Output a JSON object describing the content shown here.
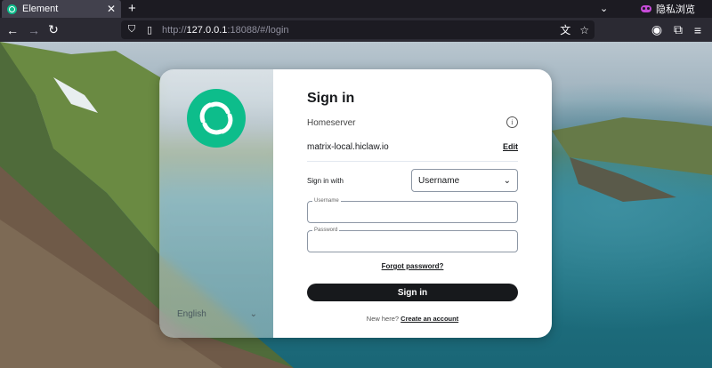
{
  "browser": {
    "tab": {
      "title": "Element",
      "favicon": "element-icon",
      "close_label": "✕"
    },
    "new_tab_label": "+",
    "private_label": "隐私浏览",
    "url": {
      "prefix": "http://",
      "host": "127.0.0.1",
      "rest": ":18088/#/login"
    }
  },
  "login": {
    "title": "Sign in",
    "homeserver_label": "Homeserver",
    "homeserver_value": "matrix-local.hiclaw.io",
    "edit_label": "Edit",
    "sign_in_with_label": "Sign in with",
    "method_selected": "Username",
    "username_label": "Username",
    "password_label": "Password",
    "forgot_label": "Forgot password?",
    "submit_label": "Sign in",
    "new_here_label": "New here?",
    "create_account_label": "Create an account"
  },
  "language": {
    "selected": "English"
  },
  "colors": {
    "brand": "#0dbd8b",
    "button": "#17191c",
    "chrome": "#1c1b22"
  }
}
